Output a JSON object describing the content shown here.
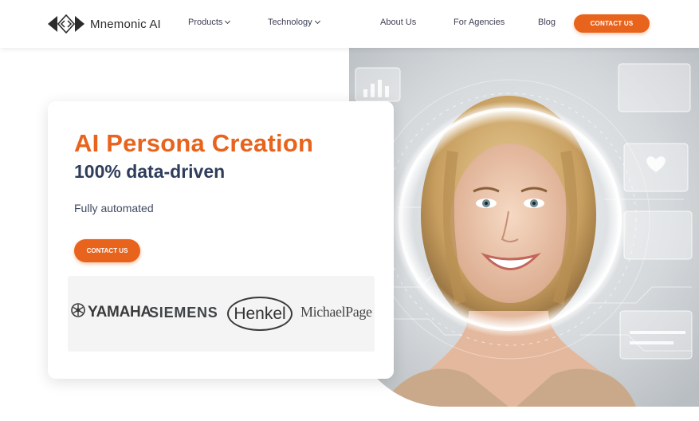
{
  "header": {
    "logo_text": "Mnemonic AI",
    "nav": {
      "products": "Products",
      "technology": "Technology",
      "about": "About Us",
      "agencies": "For Agencies",
      "blog": "Blog"
    },
    "cta_label": "CONTACT US"
  },
  "hero": {
    "title": "AI Persona Creation",
    "subtitle": "100% data-driven",
    "tagline": "Fully automated",
    "cta_label": "CONTACT US"
  },
  "clients": {
    "yamaha": "YAMAHA",
    "siemens": "SIEMENS",
    "henkel": "Henkel",
    "michael_page": "MichaelPage"
  },
  "colors": {
    "accent": "#e8631c",
    "heading_dark": "#2f3d5c",
    "nav_text": "#3c3f52"
  },
  "icons": {
    "logo": "mnemonic-logo-icon",
    "dropdown": "chevron-down-icon",
    "yamaha": "yamaha-tuning-fork-icon"
  }
}
